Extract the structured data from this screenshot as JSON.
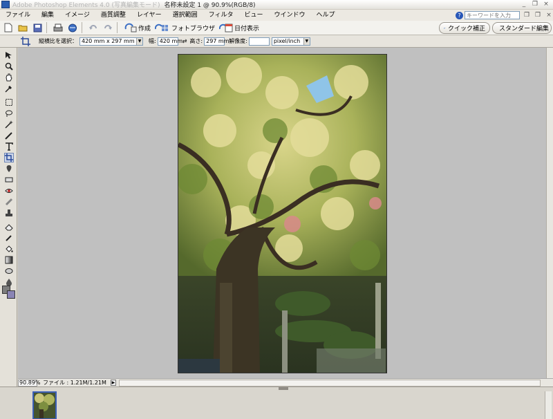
{
  "titlebar": {
    "app_name": "Adobe Photoshop Elements 4.0 (写真編集モード)",
    "document": "名称未設定 1 @ 90.9%(RGB/8)",
    "minimize": "_",
    "restore": "❐",
    "close": "×"
  },
  "menubar": {
    "items": [
      "ファイル",
      "編集",
      "イメージ",
      "画質調整",
      "レイヤー",
      "選択範囲",
      "フィルタ",
      "ビュー",
      "ウインドウ",
      "ヘルプ"
    ],
    "help_placeholder": "キーワードを入力",
    "doc_minimize": "❐",
    "doc_restore": "❐",
    "doc_close": "×"
  },
  "shortcutbar": {
    "create_label": "作成",
    "photo_browser_label": "フォトブラウザ",
    "date_view_label": "日付表示",
    "quick_fix_label": "クイック補正",
    "standard_edit_label": "スタンダード編集"
  },
  "optionsbar": {
    "aspect_label": "縦横比を選択：",
    "aspect_value": "420 mm x 297 mm",
    "width_label": "幅:",
    "width_value": "420 mm",
    "swap_symbol": "⇄",
    "height_label": "高さ:",
    "height_value": "297 mm",
    "resolution_label": "解像度:",
    "resolution_value": "",
    "resolution_unit": "pixel/inch"
  },
  "statusbar": {
    "zoom": "90.89%",
    "file_info": "ファイル : 1.21M/1.21M",
    "arrow": "▶"
  },
  "colors": {
    "foreground": "#7d7d7d",
    "background": "#8a84b4",
    "accent": "#3b5fb8"
  },
  "icons": {
    "new": "new-file-icon",
    "open": "open-folder-icon",
    "save": "save-icon",
    "print": "print-icon",
    "online": "online-service-icon",
    "undo": "undo-icon",
    "redo": "redo-icon"
  }
}
